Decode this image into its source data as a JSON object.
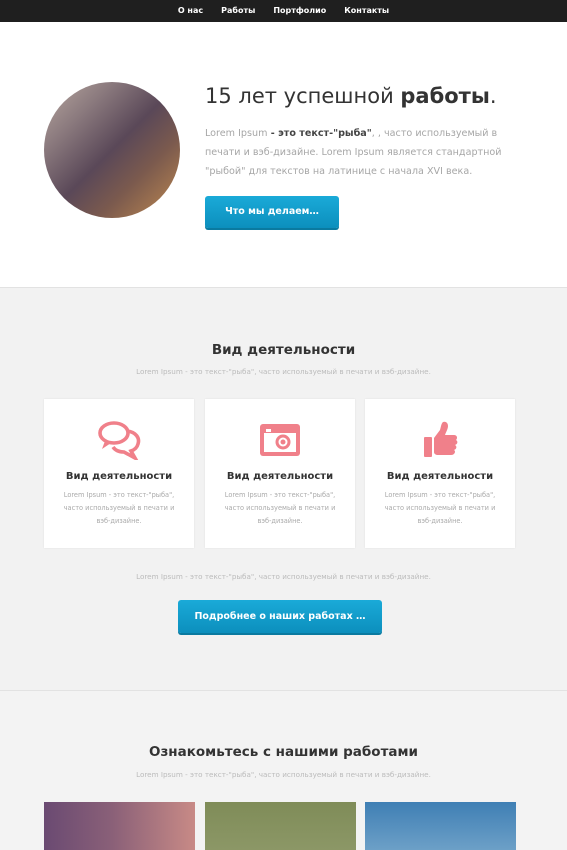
{
  "nav": {
    "items": [
      {
        "label": "О нас"
      },
      {
        "label": "Работы"
      },
      {
        "label": "Портфолио"
      },
      {
        "label": "Контакты"
      }
    ]
  },
  "hero": {
    "title_plain": "15 лет успешной ",
    "title_bold": "работы",
    "title_end": ".",
    "text_lead": "Lorem Ipsum",
    "text_strong": " - это текст-\"рыба\"",
    "text_rest": ", , часто используемый в печати и вэб-дизайне. Lorem Ipsum является стандартной \"рыбой\" для текстов на латинице с начала XVI века.",
    "button_label": "Что мы делаем…"
  },
  "services": {
    "title": "Вид деятельности",
    "subtitle": "Lorem Ipsum - это текст-\"рыба\", часто используемый в печати и вэб-дизайне.",
    "cards": [
      {
        "icon": "chat-bubbles-icon",
        "title": "Вид деятельности",
        "text": "Lorem Ipsum - это текст-\"рыба\", часто используемый в печати и вэб-дизайне."
      },
      {
        "icon": "camera-icon",
        "title": "Вид деятельности",
        "text": "Lorem Ipsum - это текст-\"рыба\", часто используемый в печати и вэб-дизайне."
      },
      {
        "icon": "thumbs-up-icon",
        "title": "Вид деятельности",
        "text": "Lorem Ipsum - это текст-\"рыба\", часто используемый в печати и вэб-дизайне."
      }
    ],
    "footer_text": "Lorem Ipsum - это текст-\"рыба\", часто используемый в печати и вэб-дизайне.",
    "button_label": "Подробнее о наших работах …"
  },
  "works": {
    "title": "Ознакомьтесь с нашими работами",
    "subtitle": "Lorem Ipsum - это текст-\"рыба\", часто используемый в печати и вэб-дизайне."
  },
  "colors": {
    "accent": "#0c9fd0",
    "icon_pink": "#f0808a",
    "nav_bg": "#1f1f1f"
  }
}
